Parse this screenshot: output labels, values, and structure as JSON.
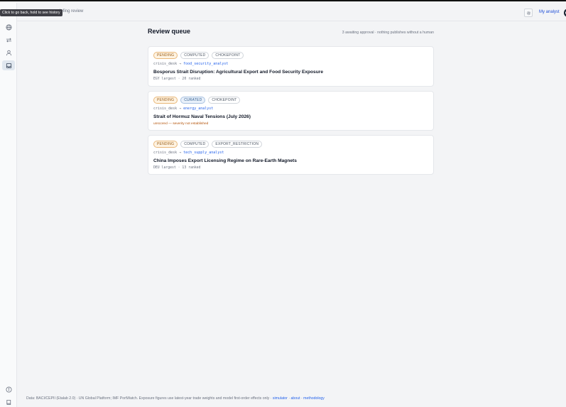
{
  "topbar": {
    "tooltip": "Click to go back, hold to see history",
    "breadcrumb": "iefing review",
    "user_label": "My analyst"
  },
  "main": {
    "title": "Review queue",
    "subtitle": "3 awaiting approval · nothing publishes without a human"
  },
  "cards": [
    {
      "badges": [
        "PENDING",
        "COMPUTED",
        "CHOKEPOINT"
      ],
      "source": "crisis_desk →",
      "target": "food_security_analyst",
      "title": "Bosporus Strait Disruption: Agricultural Export and Food Security Exposure",
      "meta": "EGY largest · 20 ranked"
    },
    {
      "badges": [
        "PENDING",
        "CURATED",
        "CHOKEPOINT"
      ],
      "source": "crisis_desk →",
      "target": "energy_analyst",
      "title": "Strait of Hormuz Naval Tensions (July 2026)",
      "meta": "unscored — severity not established"
    },
    {
      "badges": [
        "PENDING",
        "COMPUTED",
        "EXPORT_RESTRICTION"
      ],
      "source": "crisis_desk →",
      "target": "tech_supply_analyst",
      "title": "China Imposes Export Licensing Regime on Rare-Earth Magnets",
      "meta": "DEU largest · 13 ranked"
    }
  ],
  "footer": {
    "text": "Data: BACI/CEPII (Etalab 2.0) · UN Global Platform; IMF PortWatch. Exposure figures use latest-year trade weights and model first-order effects only ·",
    "link_simulator": "simulator",
    "sep1": "·",
    "link_about": "about",
    "sep2": "·",
    "link_methodology": "methodology"
  },
  "icons": {
    "rail": [
      "globe-icon",
      "swap-arrows-icon",
      "user-icon",
      "inbox-icon",
      "info-icon",
      "book-icon"
    ],
    "settings": "gear-icon"
  },
  "colors": {
    "pending": "#9a5b13",
    "curated": "#2f5d8f",
    "link": "#2563eb"
  }
}
